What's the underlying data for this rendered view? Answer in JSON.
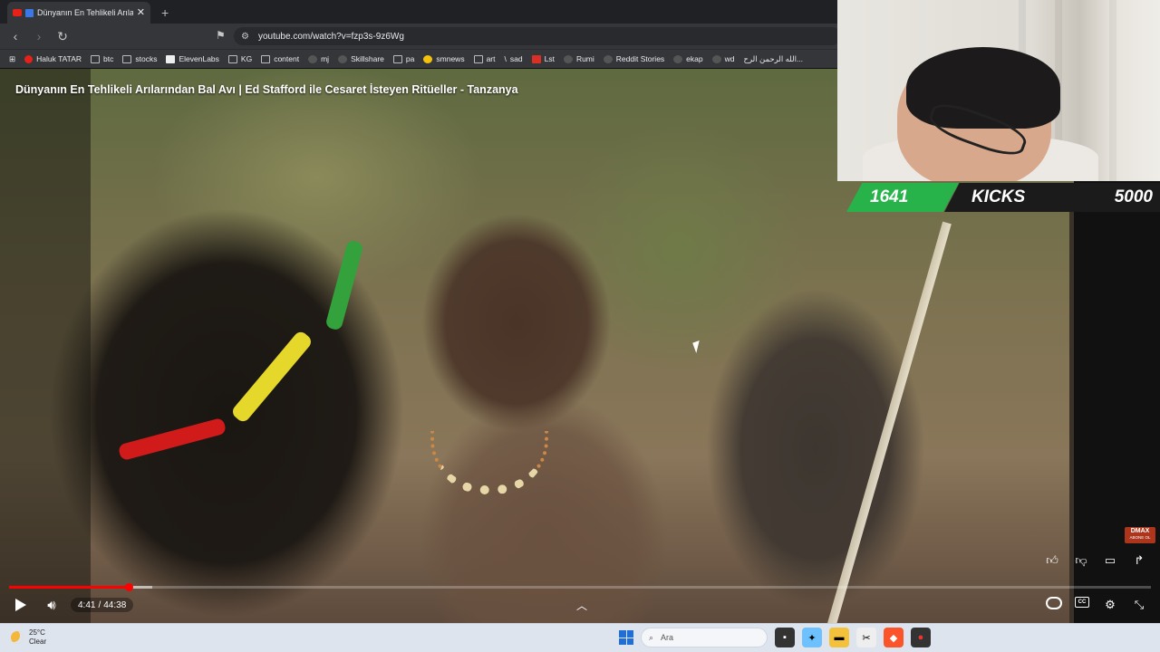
{
  "browser": {
    "tab_title": "Dünyanın En Tehlikeli Arılarından",
    "url": "youtube.com/watch?v=fzp3s-9z6Wg",
    "bookmarks": [
      "Haluk TATAR",
      "btc",
      "stocks",
      "ElevenLabs",
      "KG",
      "content",
      "mj",
      "Skillshare",
      "pa",
      "smnews",
      "art",
      "sad",
      "Lst",
      "Rumi",
      "Reddit Stories",
      "ekap",
      "wd",
      "الله الرحمن الرح..."
    ]
  },
  "video": {
    "title": "Dünyanın En Tehlikeli Arılarından Bal Avı | Ed Stafford ile Cesaret İsteyen Ritüeller - Tanzanya",
    "current_time": "4:41",
    "separator": "/",
    "duration": "44:38",
    "progress_fraction": 0.105,
    "buffered_fraction": 0.125,
    "watermark": "DMAX",
    "watermark_sub": "ABONE OL"
  },
  "overlay": {
    "count": "1641",
    "label": "KICKS",
    "goal": "5000",
    "accent": "#27b34a"
  },
  "taskbar": {
    "temperature": "25°C",
    "condition": "Clear",
    "search_placeholder": "Ara"
  }
}
